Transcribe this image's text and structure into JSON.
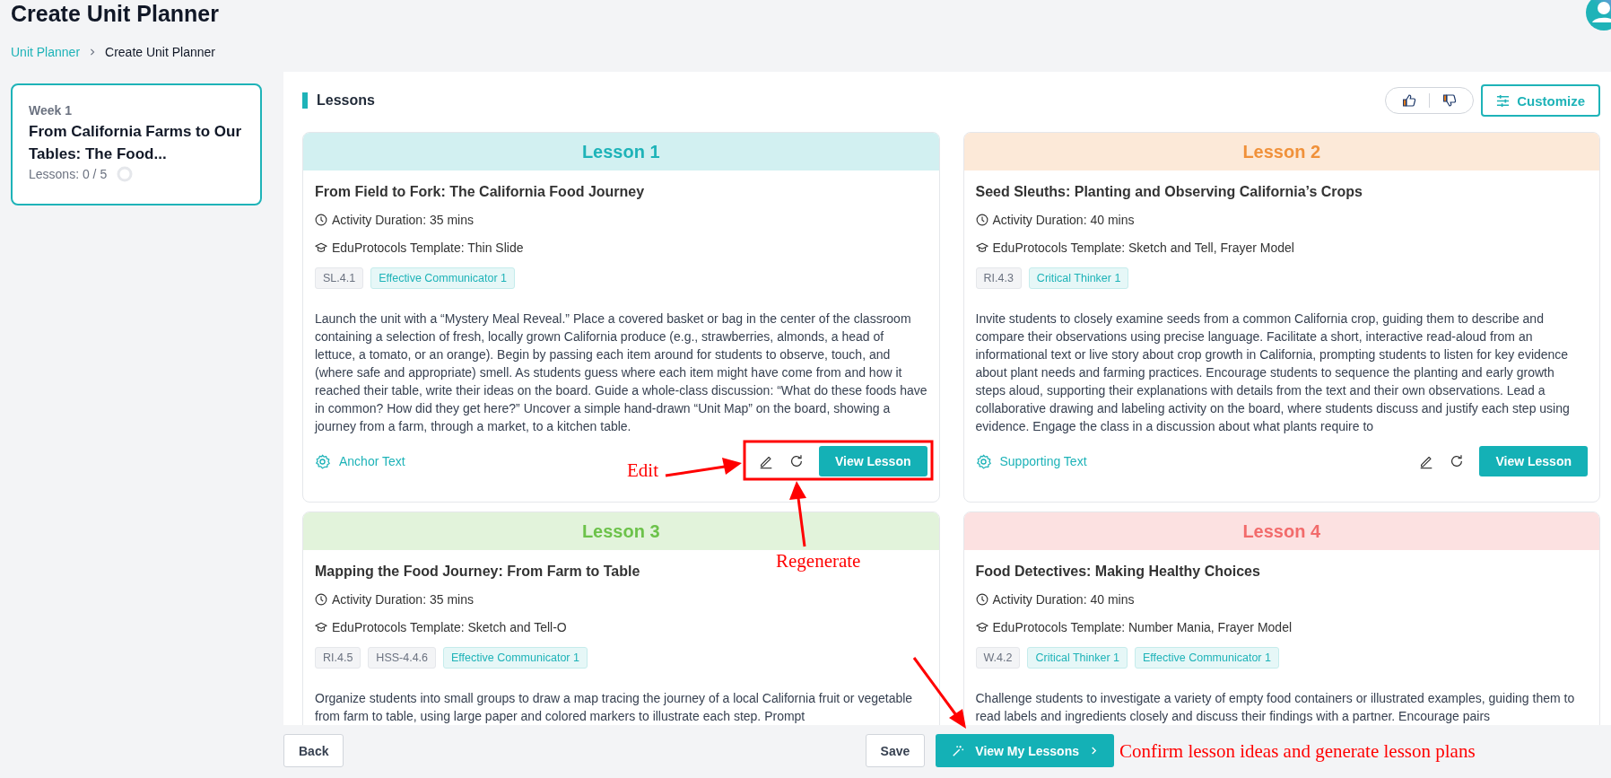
{
  "page_title": "Create Unit Planner",
  "breadcrumb": [
    {
      "label": "Unit Planner",
      "kind": "link"
    },
    {
      "label": "Create Unit Planner",
      "kind": "current"
    }
  ],
  "sidebar": {
    "weeks": [
      {
        "week": "Week 1",
        "title": "From California Farms to Our Tables: The Food...",
        "progress": "Lessons: 0 / 5",
        "level": 0,
        "selected": true
      }
    ]
  },
  "lessons_panel": {
    "title": "Lessons",
    "customize": "Customize",
    "lessons": [
      {
        "heading": "Lesson 1",
        "color": "#1eb3b8",
        "title": "From Field to Fork: The California Food Journey",
        "duration": "Activity Duration: 35 mins",
        "template": "EduProtocols Template: Thin Slide",
        "tags": [
          {
            "label": "SL.4.1",
            "kind": "standard"
          },
          {
            "label": "Effective Communicator 1",
            "kind": "competency"
          }
        ],
        "description": "Launch the unit with a “Mystery Meal Reveal.” Place a covered basket or bag in the center of the classroom containing a selection of fresh, locally grown California produce (e.g., strawberries, almonds, a head of lettuce, a tomato, or an orange). Begin by passing each item around for students to observe, touch, and (where safe and appropriate) smell. As students guess where each item might have come from and how it reached their table, write their ideas on the board. Guide a whole-class discussion: “What do these foods have in common? How did they get here?” Uncover a simple hand-drawn “Unit Map” on the board, showing a journey from a farm, through a market, to a kitchen table.",
        "text_link": "Anchor Text",
        "action": "View Lesson"
      },
      {
        "heading": "Lesson 2",
        "color": "#f0913a",
        "title": "Seed Sleuths: Planting and Observing California’s Crops",
        "duration": "Activity Duration: 40 mins",
        "template": "EduProtocols Template: Sketch and Tell, Frayer Model",
        "tags": [
          {
            "label": "RI.4.3",
            "kind": "standard"
          },
          {
            "label": "Critical Thinker 1",
            "kind": "competency"
          }
        ],
        "description": "Invite students to closely examine seeds from a common California crop, guiding them to describe and compare their observations using precise language. Facilitate a short, interactive read-aloud from an informational text or live story about crop growth in California, prompting students to listen for key evidence about plant needs and farming practices. Encourage students to sequence the planting and early growth steps aloud, supporting their explanations with details from the text and their own observations. Lead a collaborative drawing and labeling activity on the board, where students discuss and justify each step using evidence. Engage the class in a discussion about what plants require to",
        "text_link": "Supporting Text",
        "action": "View Lesson"
      },
      {
        "heading": "Lesson 3",
        "color": "#6cc24a",
        "title": "Mapping the Food Journey: From Farm to Table",
        "duration": "Activity Duration: 35 mins",
        "template": "EduProtocols Template: Sketch and Tell-O",
        "tags": [
          {
            "label": "RI.4.5",
            "kind": "standard"
          },
          {
            "label": "HSS-4.4.6",
            "kind": "standard"
          },
          {
            "label": "Effective Communicator 1",
            "kind": "competency"
          }
        ],
        "description": "Organize students into small groups to draw a map tracing the journey of a local California fruit or vegetable from farm to table, using large paper and colored markers to illustrate each step. Prompt"
      },
      {
        "heading": "Lesson 4",
        "color": "#f26b6b",
        "title": "Food Detectives: Making Healthy Choices",
        "duration": "Activity Duration: 40 mins",
        "template": "EduProtocols Template: Number Mania, Frayer Model",
        "tags": [
          {
            "label": "W.4.2",
            "kind": "standard"
          },
          {
            "label": "Critical Thinker 1",
            "kind": "competency"
          },
          {
            "label": "Effective Communicator 1",
            "kind": "competency"
          }
        ],
        "description": "Challenge students to investigate a variety of empty food containers or illustrated examples, guiding them to read labels and ingredients closely and discuss their findings with a partner. Encourage pairs"
      }
    ]
  },
  "footer": {
    "back": "Back",
    "save": "Save",
    "primary": "View My Lessons"
  },
  "annotations": [
    {
      "text": "Edit"
    },
    {
      "text": "Regenerate"
    },
    {
      "text": "Confirm lesson ideas and generate lesson plans"
    }
  ]
}
